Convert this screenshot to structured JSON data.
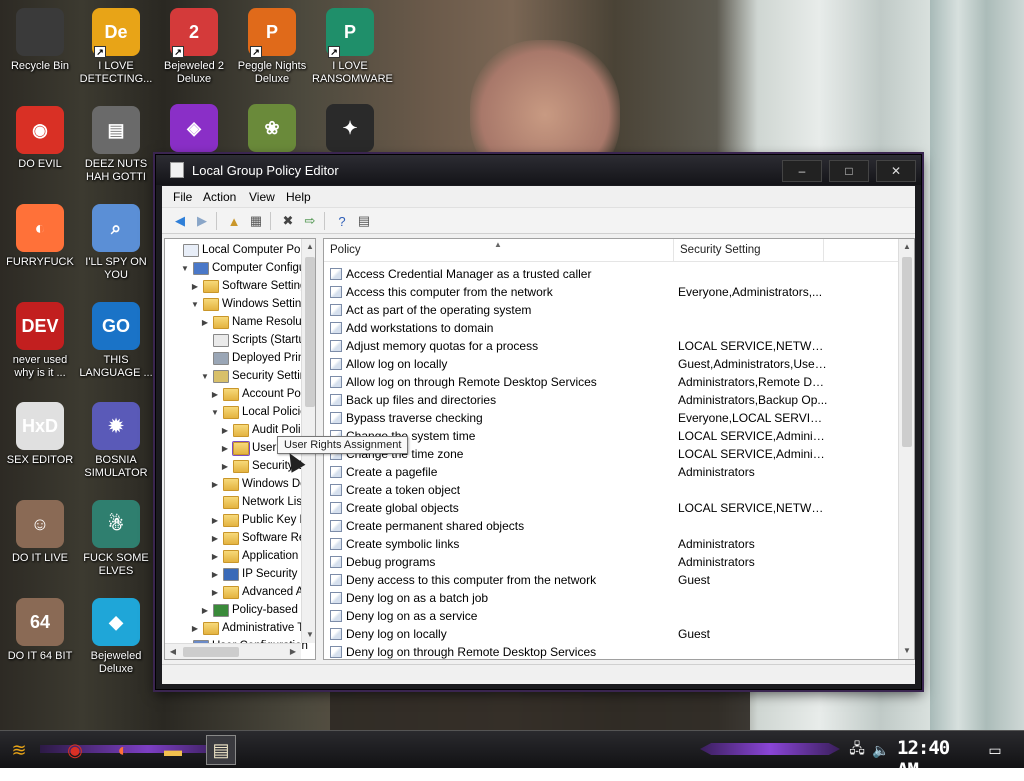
{
  "desktop_icons": [
    {
      "label": "Recycle Bin",
      "icon": "recycle-bin-icon",
      "color": "#3a3a3a",
      "glyph": "",
      "shortcut": false
    },
    {
      "label": "I LOVE DETECTING...",
      "icon": "detect-it-easy-icon",
      "color": "#e8a417",
      "glyph": "De",
      "shortcut": true
    },
    {
      "label": "Bejeweled 2 Deluxe",
      "icon": "bejeweled-2-icon",
      "color": "#d43a3a",
      "glyph": "2",
      "shortcut": true
    },
    {
      "label": "Peggle Nights Deluxe",
      "icon": "peggle-nights-icon",
      "color": "#e06a1a",
      "glyph": "P",
      "shortcut": true
    },
    {
      "label": "I LOVE RANSOMWARE",
      "icon": "publisher-icon",
      "color": "#1f8f6a",
      "glyph": "P",
      "shortcut": true
    },
    {
      "label": "DO EVIL",
      "icon": "chrome-icon",
      "color": "#d93025",
      "glyph": "◉",
      "shortcut": false
    },
    {
      "label": "DEEZ NUTS HAH GOTTI",
      "icon": "windows-stack-icon",
      "color": "#6a6a6a",
      "glyph": "▤",
      "shortcut": false
    },
    {
      "label": "FURRYFUCK",
      "icon": "firefox-icon",
      "color": "#ff7139",
      "glyph": "◐",
      "shortcut": false
    },
    {
      "label": "I'LL SPY ON YOU",
      "icon": "spy-tool-icon",
      "color": "#5b8fd6",
      "glyph": "⌕",
      "shortcut": false
    },
    {
      "label": "never used why is it ...",
      "icon": "devcpp-icon",
      "color": "#c21f1f",
      "glyph": "DEV",
      "shortcut": false
    },
    {
      "label": "THIS LANGUAGE ...",
      "icon": "goland-icon",
      "color": "#1a73c7",
      "glyph": "GO",
      "shortcut": false
    },
    {
      "label": "SEX EDITOR",
      "icon": "hxd-icon",
      "color": "#e0e0e0",
      "glyph": "HxD",
      "shortcut": false
    },
    {
      "label": "BOSNIA SIMULATOR",
      "icon": "mine-icon",
      "color": "#5a5ab8",
      "glyph": "✹",
      "shortcut": false
    },
    {
      "label": "DO IT LIVE",
      "icon": "portrait-icon",
      "color": "#8a6a55",
      "glyph": "☺",
      "shortcut": false
    },
    {
      "label": "FUCK SOME ELVES",
      "icon": "elf-game-icon",
      "color": "#2f7f6f",
      "glyph": "☃",
      "shortcut": false
    },
    {
      "label": "DO IT 64 BIT",
      "icon": "portrait-64-icon",
      "color": "#8a6a55",
      "glyph": "64",
      "shortcut": false
    },
    {
      "label": "Bejeweled Deluxe",
      "icon": "diamond-icon",
      "color": "#1fa6d8",
      "glyph": "◆",
      "shortcut": false
    },
    {
      "label": "",
      "icon": "bejeweled-3-icon",
      "color": "#8a2fc7",
      "glyph": "◈",
      "shortcut": false
    },
    {
      "label": "",
      "icon": "plant-icon",
      "color": "#6a8a3a",
      "glyph": "❀",
      "shortcut": false
    },
    {
      "label": "",
      "icon": "dragon-icon",
      "color": "#2a2a2a",
      "glyph": "✦",
      "shortcut": false
    }
  ],
  "window": {
    "title": "Local Group Policy Editor",
    "minimize": "–",
    "maximize": "□",
    "close": "✕",
    "accent": "#6a38a8"
  },
  "menu": [
    "File",
    "Action",
    "View",
    "Help"
  ],
  "toolbar": [
    {
      "icon": "back-arrow-icon",
      "glyph": "◀",
      "color": "#2f7fd8"
    },
    {
      "icon": "forward-arrow-icon",
      "glyph": "▶",
      "color": "#8aa6c8"
    },
    {
      "icon": "up-folder-icon",
      "glyph": "▲",
      "color": "#c9962a"
    },
    {
      "icon": "show-hide-tree-icon",
      "glyph": "▦",
      "color": "#555555"
    },
    {
      "icon": "delete-icon",
      "glyph": "✖",
      "color": "#444444"
    },
    {
      "icon": "export-list-icon",
      "glyph": "⇨",
      "color": "#3a8a3a"
    },
    {
      "icon": "help-icon",
      "glyph": "?",
      "color": "#2f5fb8"
    },
    {
      "icon": "properties-icon",
      "glyph": "▤",
      "color": "#555555"
    }
  ],
  "tree": [
    {
      "label": "Local Computer Policy",
      "indent": 0,
      "exp": "",
      "icon": "policy"
    },
    {
      "label": "Computer Configuration",
      "indent": 1,
      "exp": "▼",
      "icon": "computer"
    },
    {
      "label": "Software Settings",
      "indent": 2,
      "exp": "▶",
      "icon": "folder"
    },
    {
      "label": "Windows Settings",
      "indent": 2,
      "exp": "▼",
      "icon": "folder"
    },
    {
      "label": "Name Resolution Policy",
      "indent": 3,
      "exp": "▶",
      "icon": "folder"
    },
    {
      "label": "Scripts (Startup/Shutdown)",
      "indent": 3,
      "exp": "",
      "icon": "script"
    },
    {
      "label": "Deployed Printers",
      "indent": 3,
      "exp": "",
      "icon": "printer"
    },
    {
      "label": "Security Settings",
      "indent": 3,
      "exp": "▼",
      "icon": "security"
    },
    {
      "label": "Account Policies",
      "indent": 4,
      "exp": "▶",
      "icon": "folder-lock"
    },
    {
      "label": "Local Policies",
      "indent": 4,
      "exp": "▼",
      "icon": "folder-lock"
    },
    {
      "label": "Audit Policy",
      "indent": 5,
      "exp": "▶",
      "icon": "folder-lock"
    },
    {
      "label": "User Rights Assignment",
      "indent": 5,
      "exp": "▶",
      "icon": "folder-lock-selected"
    },
    {
      "label": "Security Options",
      "indent": 5,
      "exp": "▶",
      "icon": "folder-lock"
    },
    {
      "label": "Windows Defender Firewall",
      "indent": 4,
      "exp": "▶",
      "icon": "folder"
    },
    {
      "label": "Network List Manager",
      "indent": 4,
      "exp": "",
      "icon": "folder"
    },
    {
      "label": "Public Key Policies",
      "indent": 4,
      "exp": "▶",
      "icon": "folder"
    },
    {
      "label": "Software Restriction",
      "indent": 4,
      "exp": "▶",
      "icon": "folder"
    },
    {
      "label": "Application Control",
      "indent": 4,
      "exp": "▶",
      "icon": "folder"
    },
    {
      "label": "IP Security Policies",
      "indent": 4,
      "exp": "▶",
      "icon": "ipsec"
    },
    {
      "label": "Advanced Audit Policy",
      "indent": 4,
      "exp": "▶",
      "icon": "folder"
    },
    {
      "label": "Policy-based QoS",
      "indent": 3,
      "exp": "▶",
      "icon": "chart"
    },
    {
      "label": "Administrative Templates",
      "indent": 2,
      "exp": "▶",
      "icon": "folder"
    },
    {
      "label": "User Configuration",
      "indent": 1,
      "exp": "▶",
      "icon": "user"
    }
  ],
  "tooltip": "User Rights Assignment",
  "list": {
    "col_policy": "Policy",
    "col_setting": "Security Setting",
    "rows": [
      [
        "Access Credential Manager as a trusted caller",
        ""
      ],
      [
        "Access this computer from the network",
        "Everyone,Administrators,..."
      ],
      [
        "Act as part of the operating system",
        ""
      ],
      [
        "Add workstations to domain",
        ""
      ],
      [
        "Adjust memory quotas for a process",
        "LOCAL SERVICE,NETWORK..."
      ],
      [
        "Allow log on locally",
        "Guest,Administrators,User..."
      ],
      [
        "Allow log on through Remote Desktop Services",
        "Administrators,Remote De..."
      ],
      [
        "Back up files and directories",
        "Administrators,Backup Op..."
      ],
      [
        "Bypass traverse checking",
        "Everyone,LOCAL SERVICE..."
      ],
      [
        "Change the system time",
        "LOCAL SERVICE,Administr..."
      ],
      [
        "Change the time zone",
        "LOCAL SERVICE,Administr..."
      ],
      [
        "Create a pagefile",
        "Administrators"
      ],
      [
        "Create a token object",
        ""
      ],
      [
        "Create global objects",
        "LOCAL SERVICE,NETWORK..."
      ],
      [
        "Create permanent shared objects",
        ""
      ],
      [
        "Create symbolic links",
        "Administrators"
      ],
      [
        "Debug programs",
        "Administrators"
      ],
      [
        "Deny access to this computer from the network",
        "Guest"
      ],
      [
        "Deny log on as a batch job",
        ""
      ],
      [
        "Deny log on as a service",
        ""
      ],
      [
        "Deny log on locally",
        "Guest"
      ],
      [
        "Deny log on through Remote Desktop Services",
        ""
      ]
    ]
  },
  "taskbar": {
    "items": [
      {
        "icon": "start-logo-icon",
        "glyph": "≋",
        "color": "#e8a417"
      },
      {
        "icon": "chrome-icon",
        "glyph": "◉",
        "color": "#d93025"
      },
      {
        "icon": "firefox-icon",
        "glyph": "◐",
        "color": "#ff7139"
      },
      {
        "icon": "file-explorer-icon",
        "glyph": "▬",
        "color": "#f2c14e"
      },
      {
        "icon": "group-policy-taskbar-icon",
        "glyph": "▤",
        "color": "#f0e6c8"
      }
    ],
    "clock": "12:40 AM"
  }
}
